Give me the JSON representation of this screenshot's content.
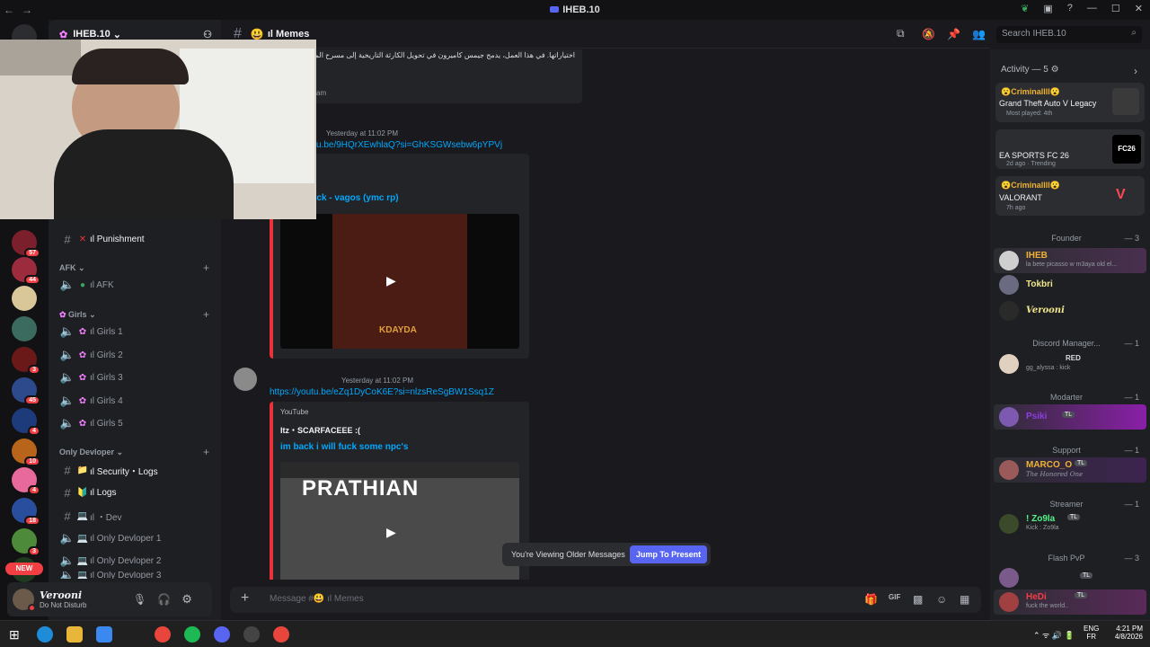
{
  "titlebar": {
    "title": "IHEB.10",
    "back": "←",
    "forward": "→"
  },
  "server": {
    "name": "IHEB.10",
    "caret": "⌄"
  },
  "guild_badges": [
    "57",
    "44",
    "3",
    "45",
    "4",
    "10",
    "4",
    "18",
    "3"
  ],
  "guild_new": "NEW",
  "sidebar": {
    "punishment": {
      "name": "ıl Punishment",
      "emoji": "✕"
    },
    "cat_afk": "AFK",
    "afk": {
      "name": "ıl AFK"
    },
    "cat_girls": "Girls",
    "girls": [
      "ıl Girls 1",
      "ıl Girls 2",
      "ıl Girls 3",
      "ıl Girls 4",
      "ıl Girls 5"
    ],
    "cat_dev": "Only Devloper",
    "dev": [
      {
        "name": "ıl Security・Logs",
        "emoji": "📁"
      },
      {
        "name": "ıl Logs",
        "emoji": "🔰"
      },
      {
        "name": "ıl ・Dev",
        "emoji": "💻"
      },
      {
        "name": "ıl Only Devloper 1",
        "emoji": "💻"
      },
      {
        "name": "ıl Only Devloper 2",
        "emoji": "💻"
      },
      {
        "name": "ıl Only Devloper 3",
        "emoji": "💻"
      }
    ]
  },
  "user": {
    "name": "Verooni",
    "status": "Do Not Disturb"
  },
  "channel": {
    "name": "ıl Memes",
    "emoji": "😃"
  },
  "search": {
    "placeholder": "Search IHEB.10"
  },
  "messages": {
    "arabic_text": "اختياراتها. في هذا العمل، يدمج جيمس كاميرون في تحويل الكارثة التاريخية إلى مسرح المشاعر، مع",
    "footer_frag": "am",
    "m1": {
      "time": "Yesterday at 11:02 PM",
      "link": "u.be/9HQrXEwhlaQ?si=GhKSGWsebw6pYPVj",
      "title": "'ck - vagos (ymc rp)",
      "thumb_text": "KDAYDA"
    },
    "m2": {
      "time": "Yesterday at 11:02 PM",
      "link": "https://youtu.be/eZq1DyCoK6E?si=nlzsReSgBW1Ssq1Z",
      "provider": "YouTube",
      "author": "Itz・SCARFACEEE :(",
      "title": "im back i will fuck some npc's",
      "thumb_text": "PRATHIAN"
    }
  },
  "older_bar": {
    "label": "You're Viewing Older Messages",
    "button": "Jump To Present"
  },
  "composer": {
    "placeholder": "Message #😃 ıl Memes",
    "plus": "+"
  },
  "members": {
    "activity_header": "Activity — 5",
    "activities": [
      {
        "user": "😮Criminallll😮",
        "game": "Grand Theft Auto V Legacy",
        "meta": "Most played: 4th"
      },
      {
        "user": "",
        "game": "EA SPORTS FC 26",
        "meta": "2d ago · Trending",
        "logo": "FC26"
      },
      {
        "user": "😮Criminallll😮",
        "game": "VALORANT",
        "meta": "7h ago"
      }
    ],
    "roles": [
      {
        "name": "Founder",
        "count": "— 3"
      },
      {
        "name": "Discord Manager...",
        "count": "— 1"
      },
      {
        "name": "Modarter",
        "count": "— 1"
      },
      {
        "name": "Support",
        "count": "— 1"
      },
      {
        "name": "Streamer",
        "count": "— 1"
      },
      {
        "name": "Flash PvP",
        "count": "— 3"
      }
    ],
    "list": [
      {
        "name": "IHEB",
        "status": "la bete picasso w m3aya old el..."
      },
      {
        "name": "Tokbri",
        "status": ""
      },
      {
        "name": "Verooni",
        "status": ""
      },
      {
        "name": "RED",
        "status": "gg_alyssa : kick"
      },
      {
        "name": "Psiki",
        "tag": "TL"
      },
      {
        "name": "MARCO_O",
        "tag": "TL",
        "status": "The Honored One"
      },
      {
        "name": "! Zo9la",
        "tag": "TL",
        "status": "Kick : Zo9la"
      },
      {
        "name": "",
        "tag": "TL"
      },
      {
        "name": "HeDi",
        "tag": "TL",
        "status": "fuck the world.."
      }
    ]
  },
  "taskbar": {
    "lang1": "ENG",
    "lang2": "FR",
    "time": "4:21 PM",
    "date": "4/8/2026"
  },
  "colors": {
    "accent": "#5865f2",
    "embed_bar": "#e8333b",
    "link": "#00a8fc",
    "bg": "#1a1a1e"
  }
}
